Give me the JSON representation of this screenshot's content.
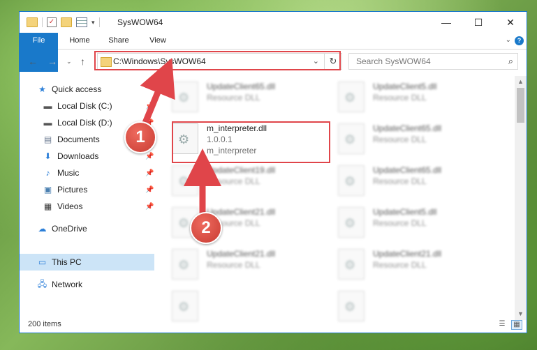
{
  "window": {
    "title": "SysWOW64"
  },
  "titlebar": {
    "minimize": "—",
    "maximize": "☐",
    "close": "✕"
  },
  "ribbon": {
    "tabs": [
      "File",
      "Home",
      "Share",
      "View"
    ]
  },
  "address": {
    "path": "C:\\Windows\\SysWOW64"
  },
  "search": {
    "placeholder": "Search SysWOW64"
  },
  "nav": {
    "items": [
      {
        "label": "Quick access",
        "icon": "star-icon"
      },
      {
        "label": "Local Disk (C:)",
        "icon": "drive-icon",
        "pinned": true
      },
      {
        "label": "Local Disk (D:)",
        "icon": "drive-icon",
        "pinned": true
      },
      {
        "label": "Documents",
        "icon": "documents-icon",
        "pinned": true
      },
      {
        "label": "Downloads",
        "icon": "download-icon",
        "pinned": true
      },
      {
        "label": "Music",
        "icon": "music-icon",
        "pinned": true
      },
      {
        "label": "Pictures",
        "icon": "pictures-icon",
        "pinned": true
      },
      {
        "label": "Videos",
        "icon": "videos-icon",
        "pinned": true
      },
      {
        "label": "OneDrive",
        "icon": "cloud-icon"
      },
      {
        "label": "This PC",
        "icon": "pc-icon",
        "selected": true
      },
      {
        "label": "Network",
        "icon": "network-icon"
      }
    ]
  },
  "files": [
    {
      "name": "UpdateClient65.dll",
      "type": "Resource DLL",
      "blurred": true
    },
    {
      "name": "UpdateClient5.dll",
      "type": "Resource DLL",
      "blurred": true
    },
    {
      "name": "m_interpreter.dll",
      "type": "1.0.0.1",
      "extra": "m_interpreter",
      "blurred": false
    },
    {
      "name": "UpdateClient65.dll",
      "type": "Resource DLL",
      "blurred": true
    },
    {
      "name": "UpdateClient19.dll",
      "type": "Resource DLL",
      "blurred": true
    },
    {
      "name": "UpdateClient65.dll",
      "type": "Resource DLL",
      "blurred": true
    },
    {
      "name": "UpdateClient21.dll",
      "type": "Resource DLL",
      "blurred": true
    },
    {
      "name": "UpdateClient5.dll",
      "type": "Resource DLL",
      "blurred": true
    },
    {
      "name": "UpdateClient21.dll",
      "type": "Resource DLL",
      "blurred": true
    },
    {
      "name": "UpdateClient21.dll",
      "type": "Resource DLL",
      "blurred": true
    },
    {
      "name": "",
      "type": "",
      "blurred": true
    },
    {
      "name": "",
      "type": "",
      "blurred": true
    }
  ],
  "status": {
    "count": "200 items"
  },
  "annotations": {
    "badge1": "1",
    "badge2": "2",
    "color": "#e0454a"
  }
}
